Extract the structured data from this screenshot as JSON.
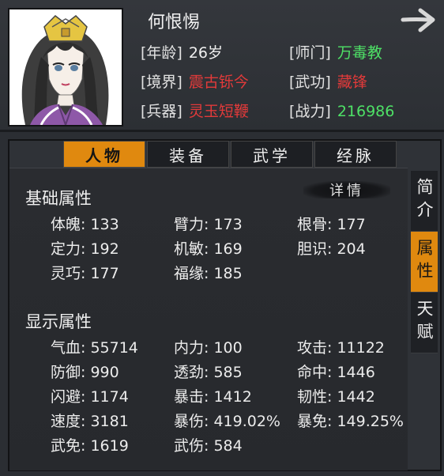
{
  "character": {
    "name": "何恨惕",
    "info": [
      {
        "label": "[年龄]",
        "value": "26岁",
        "tone": "white"
      },
      {
        "label": "[师门]",
        "value": "万毒教",
        "tone": "green"
      },
      {
        "label": "[境界]",
        "value": "震古铄今",
        "tone": "red"
      },
      {
        "label": "[武功]",
        "value": "藏锋",
        "tone": "red"
      },
      {
        "label": "[兵器]",
        "value": "灵玉短鞭",
        "tone": "red"
      },
      {
        "label": "[战力]",
        "value": "216986",
        "tone": "green"
      }
    ]
  },
  "tabs": [
    "人物",
    "装备",
    "武学",
    "经脉"
  ],
  "active_tab": "人物",
  "side_tabs": [
    "简介",
    "属性",
    "天赋"
  ],
  "active_side_tab": "属性",
  "detail_label": "详情",
  "base_attributes": {
    "title": "基础属性",
    "items": [
      "体魄: 133",
      "臂力: 173",
      "根骨: 177",
      "定力: 192",
      "机敏: 169",
      "胆识: 204",
      "灵巧: 177",
      "福缘: 185"
    ]
  },
  "display_attributes": {
    "title": "显示属性",
    "items": [
      "气血: 55714",
      "内力: 100",
      "攻击: 11122",
      "防御: 990",
      "透劲: 585",
      "命中: 1446",
      "闪避: 1174",
      "暴击: 1412",
      "韧性: 1442",
      "速度: 3181",
      "暴伤: 419.02%",
      "暴免: 149.25%",
      "武免: 1619",
      "武伤: 584"
    ]
  },
  "colors": {
    "accent": "#e0890f",
    "red": "#e23a3a",
    "green": "#4ee066"
  }
}
